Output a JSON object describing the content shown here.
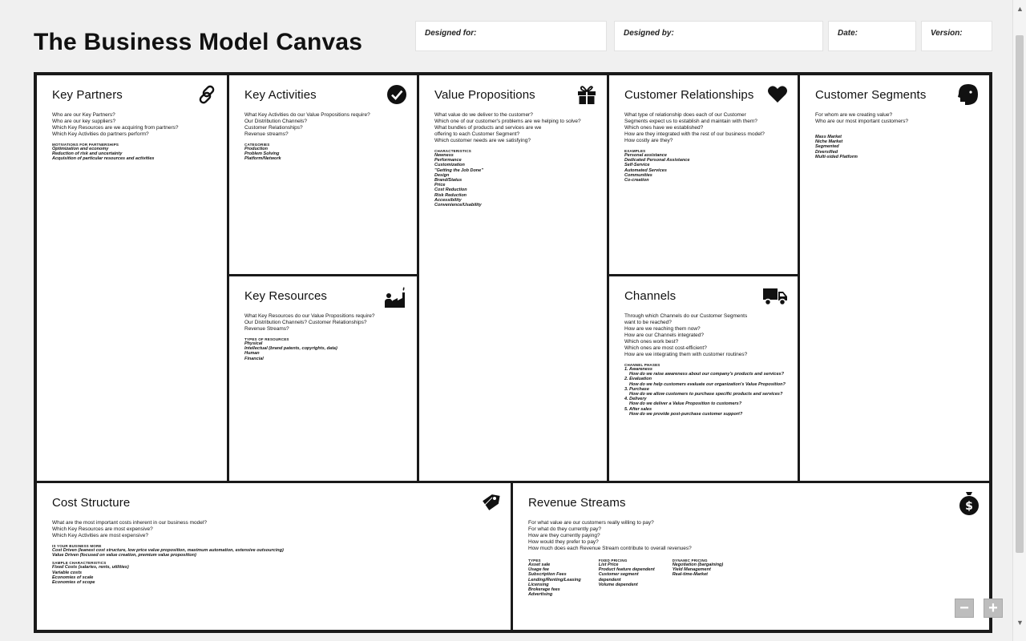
{
  "page": {
    "title": "The Business Model Canvas",
    "designed_for": "Designed for:",
    "designed_by": "Designed by:",
    "date": "Date:",
    "version": "Version:"
  },
  "blocks": {
    "key_partners": {
      "title": "Key Partners",
      "icon": "link-icon",
      "questions": [
        "Who are our Key Partners?",
        "Who are our key suppliers?",
        "Which Key Resources are we acquiring from partners?",
        "Which Key Activities do partners perform?"
      ],
      "label": "MOTIVATIONS FOR PARTNERSHIPS",
      "items": [
        "Optimization and economy",
        "Reduction of risk and uncertainty",
        "Acquisition of particular resources and activities"
      ]
    },
    "key_activities": {
      "title": "Key Activities",
      "icon": "checkmark-icon",
      "questions": [
        "What Key Activities do our Value Propositions require?",
        "Our Distribution Channels?",
        "Customer Relationships?",
        "Revenue streams?"
      ],
      "label": "CATEGORIES",
      "items": [
        "Production",
        "Problem Solving",
        "Platform/Network"
      ]
    },
    "key_resources": {
      "title": "Key Resources",
      "icon": "factory-worker-icon",
      "questions": [
        "What Key Resources do our Value Propositions require?",
        "Our Distribution Channels? Customer Relationships?",
        "Revenue Streams?"
      ],
      "label": "TYPES OF RESOURCES",
      "items": [
        "Physical",
        "Intellectual (brand patents, copyrights, data)",
        "Human",
        "Financial"
      ]
    },
    "value_propositions": {
      "title": "Value Propositions",
      "icon": "gift-icon",
      "questions": [
        "What value do we deliver to the customer?",
        "Which one of our customer's problems are we helping to solve?",
        "What bundles of products and services are we",
        "offering to each Customer Segment?",
        "Which customer needs are we satisfying?"
      ],
      "label": "CHARACTERISTICS",
      "items": [
        "Newness",
        "Performance",
        "Customization",
        "\"Getting the Job Done\"",
        "Design",
        "Brand/Status",
        "Price",
        "Cost Reduction",
        "Risk Reduction",
        "Accessibility",
        "Convenience/Usability"
      ]
    },
    "customer_relationships": {
      "title": "Customer Relationships",
      "icon": "heart-icon",
      "questions": [
        "What type of relationship does each of our Customer",
        "Segments expect us to establish and maintain with them?",
        "Which ones have we established?",
        "How are they integrated with the rest of our business model?",
        "How costly are they?"
      ],
      "label": "EXAMPLES",
      "items": [
        "Personal assistance",
        "Dedicated Personal Assistance",
        "Self-Service",
        "Automated Services",
        "Communities",
        "Co-creation"
      ]
    },
    "channels": {
      "title": "Channels",
      "icon": "truck-icon",
      "questions": [
        "Through which Channels do our Customer Segments",
        "want to be reached?",
        "How are we reaching them now?",
        "How are our Channels integrated?",
        "Which ones work best?",
        "Which ones are most cost-efficient?",
        "How are we integrating them with customer routines?"
      ],
      "label": "CHANNEL PHASES",
      "phases": [
        {
          "name": "1. Awareness",
          "desc": "How do we raise awareness about our company's products and services?"
        },
        {
          "name": "2. Evaluation",
          "desc": "How do we help customers evaluate our organization's Value Proposition?"
        },
        {
          "name": "3. Purchase",
          "desc": "How do we allow customers to purchase specific products and services?"
        },
        {
          "name": "4. Delivery",
          "desc": "How do we deliver a Value Proposition to customers?"
        },
        {
          "name": "5. After sales",
          "desc": "How do we provide post-purchase customer support?"
        }
      ]
    },
    "customer_segments": {
      "title": "Customer Segments",
      "icon": "face-icon",
      "questions": [
        "For whom are we creating value?",
        "Who are our most important customers?"
      ],
      "items": [
        "Mass Market",
        "Niche Market",
        "Segmented",
        "Diversified",
        "Multi-sided Platform"
      ]
    },
    "cost_structure": {
      "title": "Cost Structure",
      "icon": "price-tag-icon",
      "questions": [
        "What are the most important costs inherent in our business model?",
        "Which Key Resources are most expensive?",
        "Which Key Activities are most expensive?"
      ],
      "label1": "IS YOUR BUSINESS MORE",
      "items1": [
        "Cost Driven (leanest cost structure, low price value proposition, maximum automation, extensive outsourcing)",
        "Value Driven (focused on value creation, premium value proposition)"
      ],
      "label2": "SAMPLE CHARACTERISTICS",
      "items2": [
        "Fixed Costs (salaries, rents, utilities)",
        "Variable costs",
        "Economies of scale",
        "Economies of scope"
      ]
    },
    "revenue_streams": {
      "title": "Revenue Streams",
      "icon": "money-bag-icon",
      "questions": [
        "For what value are our customers really willing to pay?",
        "For what do they currently pay?",
        "How are they currently paying?",
        "How would they prefer to pay?",
        "How much does each Revenue Stream contribute to overall revenues?"
      ],
      "types_label": "TYPES",
      "types": [
        "Asset sale",
        "Usage fee",
        "Subscription Fees",
        "Lending/Renting/Leasing",
        "Licensing",
        "Brokerage fees",
        "Advertising"
      ],
      "fixed_label": "FIXED PRICING",
      "fixed": [
        "List Price",
        "Product feature dependent",
        "Customer segment",
        "dependent",
        "Volume dependent"
      ],
      "dynamic_label": "DYNAMIC PRICING",
      "dynamic": [
        "Negotiation (bargaining)",
        "Yield Management",
        "Real-time-Market"
      ]
    }
  },
  "zoom": {
    "minus": "−",
    "plus": "+"
  },
  "scrollbar": {
    "up": "▲",
    "down": "▼"
  }
}
